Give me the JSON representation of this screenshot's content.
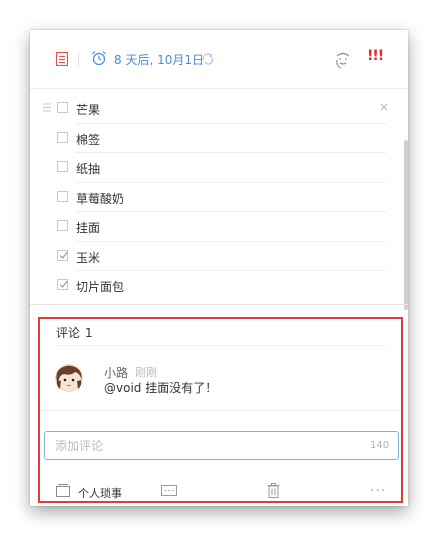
{
  "task": {
    "due_text": "8 天后, 10月1日",
    "priority_text": "!!!"
  },
  "checklist": [
    {
      "label": "芒果",
      "checked": false
    },
    {
      "label": "棉签",
      "checked": false
    },
    {
      "label": "纸抽",
      "checked": false
    },
    {
      "label": "草莓酸奶",
      "checked": false
    },
    {
      "label": "挂面",
      "checked": false
    },
    {
      "label": "玉米",
      "checked": true
    },
    {
      "label": "切片面包",
      "checked": true
    }
  ],
  "comments": {
    "title": "评论",
    "count": "1",
    "items": [
      {
        "author": "小路",
        "time": "刚刚",
        "text": "@void 挂面没有了！"
      }
    ],
    "input_placeholder": "添加评论",
    "char_limit": "140"
  },
  "footer": {
    "list_name": "个人琐事"
  },
  "colors": {
    "accent_blue": "#4a8be0",
    "priority_red": "#e22a2a",
    "highlight_red": "#e23a3a"
  },
  "icons": [
    "task-doc-icon",
    "alarm-clock-icon",
    "repeat-icon",
    "assignee-icon",
    "drag-handle-icon",
    "close-icon",
    "checkbox-icon",
    "inbox-icon",
    "comment-icon",
    "trash-icon",
    "more-icon"
  ]
}
